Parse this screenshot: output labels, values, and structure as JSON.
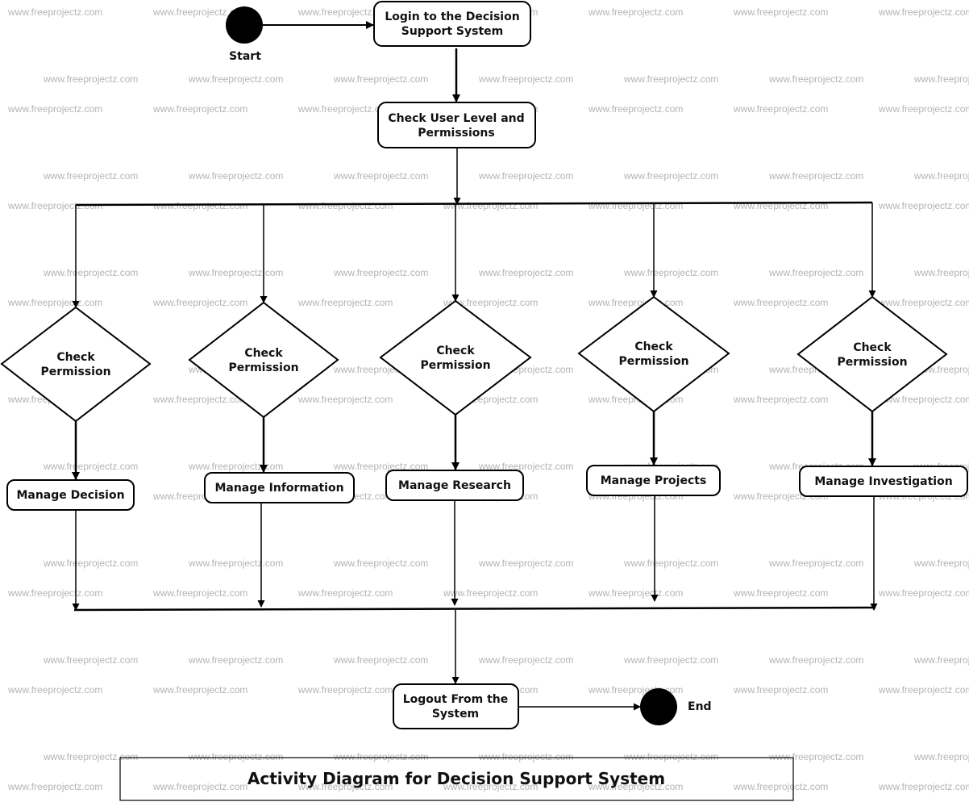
{
  "watermark": {
    "text": "www.freeprojectz.com",
    "color": "#b4b4b4"
  },
  "diagram": {
    "type": "UML activity diagram",
    "title": "Activity Diagram for Decision Support System",
    "start": {
      "label": "Start"
    },
    "end": {
      "label": "End"
    },
    "activities": {
      "login": {
        "lines": [
          "Login to the Decision",
          "Support System"
        ]
      },
      "check_user_level": {
        "lines": [
          "Check User Level and",
          "Permissions"
        ]
      },
      "logout": {
        "lines": [
          "Logout From the",
          "System"
        ]
      }
    },
    "branches": [
      {
        "decision_lines": [
          "Check",
          "Permission"
        ],
        "activity": "Manage Decision"
      },
      {
        "decision_lines": [
          "Check",
          "Permission"
        ],
        "activity": "Manage Information"
      },
      {
        "decision_lines": [
          "Check",
          "Permission"
        ],
        "activity": "Manage Research"
      },
      {
        "decision_lines": [
          "Check",
          "Permission"
        ],
        "activity": "Manage Projects"
      },
      {
        "decision_lines": [
          "Check",
          "Permission"
        ],
        "activity": "Manage Investigation"
      }
    ],
    "flows": [
      [
        "Start",
        "Login to the Decision Support System"
      ],
      [
        "Login to the Decision Support System",
        "Check User Level and Permissions"
      ],
      [
        "Check User Level and Permissions",
        "Fork"
      ],
      [
        "Fork",
        "Check Permission (x5)"
      ],
      [
        "Check Permission",
        "Manage Decision / Information / Research / Projects / Investigation"
      ],
      [
        "Manage *",
        "Join"
      ],
      [
        "Join",
        "Logout From the System"
      ],
      [
        "Logout From the System",
        "End"
      ]
    ]
  }
}
